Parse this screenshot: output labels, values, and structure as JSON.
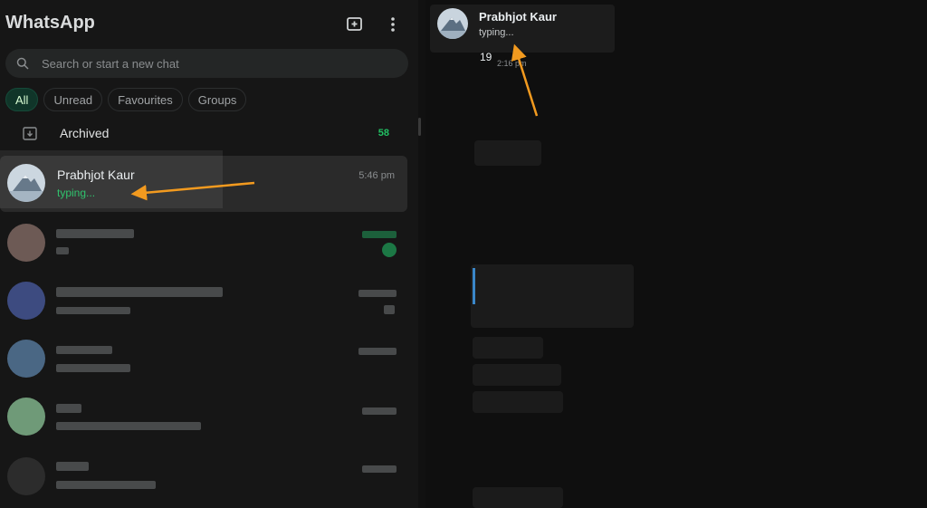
{
  "app": {
    "title": "WhatsApp"
  },
  "header": {
    "new_chat_icon": "new-chat-icon",
    "menu_icon": "kebab-menu-icon"
  },
  "search": {
    "placeholder": "Search or start a new chat"
  },
  "filters": [
    "All",
    "Unread",
    "Favourites",
    "Groups"
  ],
  "archived": {
    "label": "Archived",
    "count": "58"
  },
  "selected_chat": {
    "name": "Prabhjot Kaur",
    "last_message": "typing...",
    "time": "5:46 pm"
  },
  "conversation": {
    "contact_name": "Prabhjot Kaur",
    "status": "typing...",
    "first_message": {
      "text": "19",
      "time": "2:16 pm"
    }
  },
  "colors": {
    "accent_green": "#21c063",
    "arrow": "#f29a1f"
  }
}
